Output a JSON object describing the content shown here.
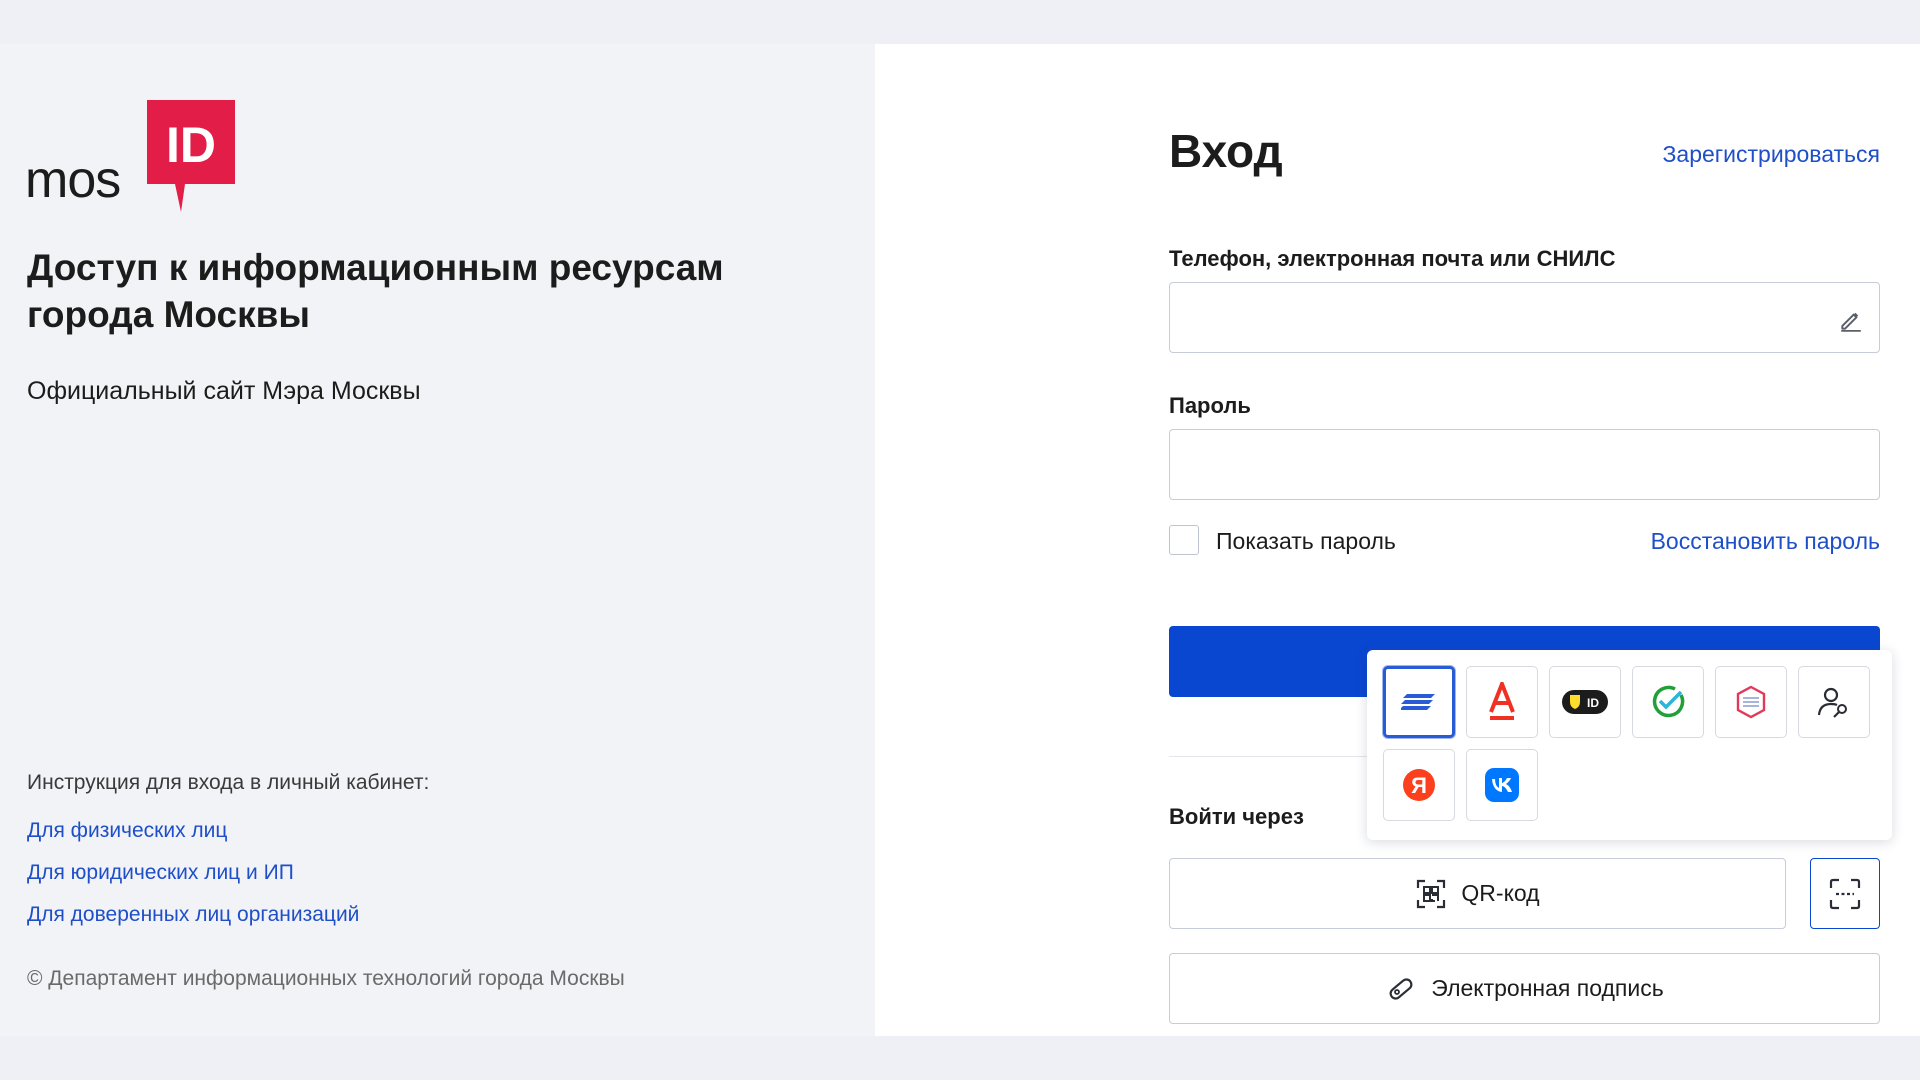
{
  "brand": {
    "logo_text": "mos",
    "logo_mark_text": "ID",
    "accent_color": "#E11D48",
    "link_color": "#1F4FC8",
    "primary_button_color": "#0A47D1"
  },
  "left": {
    "headline_line1": "Доступ к информационным ресурсам",
    "headline_line2": "города Москвы",
    "subtitle": "Официальный сайт Мэра Москвы",
    "instructions_title": "Инструкция для входа в личный кабинет:",
    "instruction_links": [
      "Для физических лиц",
      "Для юридических лиц и ИП",
      "Для доверенных лиц организаций"
    ],
    "copyright": "© Департамент информационных технологий города Москвы"
  },
  "login": {
    "title": "Вход",
    "register_link": "Зарегистрироваться",
    "login_label": "Телефон, электронная почта или СНИЛС",
    "login_value": "",
    "password_label": "Пароль",
    "password_value": "",
    "show_password_label": "Показать пароль",
    "show_password_checked": false,
    "restore_link": "Восстановить пароль",
    "submit_label": "",
    "via_label": "Войти через",
    "qr_button": "QR-код",
    "signature_button": "Электронная подпись"
  },
  "providers": [
    {
      "icon": "gosuslugi-icon",
      "active": true
    },
    {
      "icon": "alfa-bank-icon",
      "active": false
    },
    {
      "icon": "tbank-id-icon",
      "active": false
    },
    {
      "icon": "sber-id-icon",
      "active": false
    },
    {
      "icon": "esia-icon",
      "active": false
    },
    {
      "icon": "user-key-icon",
      "active": false
    },
    {
      "icon": "yandex-icon",
      "active": false
    },
    {
      "icon": "vk-icon",
      "active": false
    }
  ]
}
